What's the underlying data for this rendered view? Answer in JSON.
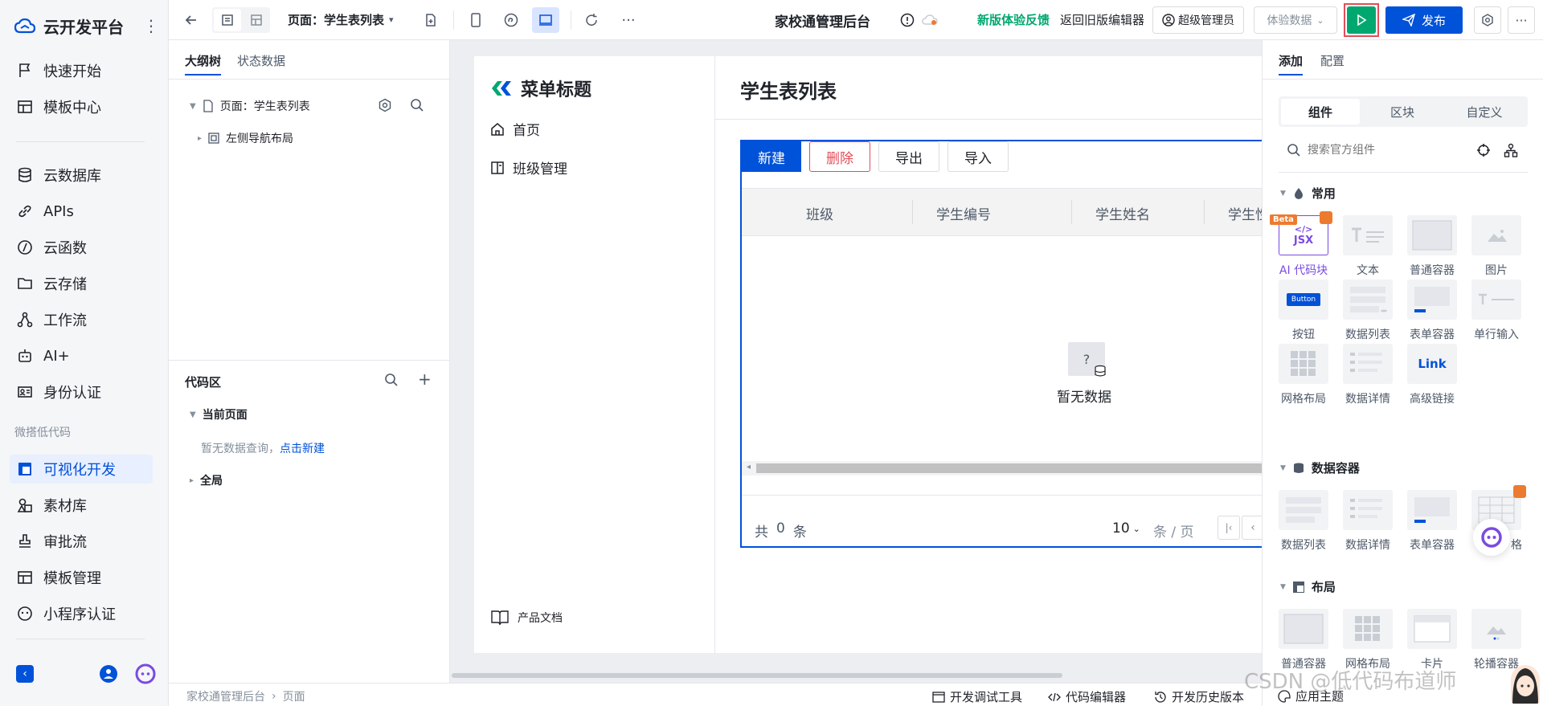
{
  "brand": {
    "name": "云开发平台"
  },
  "sidebar": {
    "items": [
      {
        "label": "快速开始"
      },
      {
        "label": "模板中心"
      },
      {
        "label": "云数据库"
      },
      {
        "label": "APIs"
      },
      {
        "label": "云函数"
      },
      {
        "label": "云存储"
      },
      {
        "label": "工作流"
      },
      {
        "label": "AI+"
      },
      {
        "label": "身份认证"
      },
      {
        "label": "可视化开发"
      },
      {
        "label": "素材库"
      },
      {
        "label": "审批流"
      },
      {
        "label": "模板管理"
      },
      {
        "label": "小程序认证"
      }
    ],
    "group_label": "微搭低代码"
  },
  "toolbar": {
    "page_selector": "页面：学生表列表",
    "app_title": "家校通管理后台",
    "feedback_link": "新版体验反馈",
    "old_editor_link": "返回旧版编辑器",
    "user_label": "超级管理员",
    "data_mode": "体验数据",
    "publish_label": "发布"
  },
  "outline": {
    "tabs": [
      "大纲树",
      "状态数据"
    ],
    "tree": {
      "page": "页面：学生表列表",
      "child": "左侧导航布局"
    },
    "code_area": {
      "title": "代码区",
      "current_page": "当前页面",
      "empty_text": "暂无数据查询，",
      "create_link": "点击新建",
      "global": "全局"
    }
  },
  "preview": {
    "menu_title": "菜单标题",
    "menu_items": [
      "首页",
      "班级管理"
    ],
    "footer_link": "产品文档",
    "page_title": "学生表列表",
    "buttons": {
      "new": "新建",
      "delete": "删除",
      "export": "导出",
      "import": "导入"
    },
    "columns": [
      "班级",
      "学生编号",
      "学生姓名",
      "学生性"
    ],
    "empty": "暂无数据",
    "total_prefix": "共",
    "total_count": "0",
    "total_suffix": "条",
    "page_size": "10",
    "page_unit": "条 / 页"
  },
  "rightpanel": {
    "tabs": [
      "添加",
      "配置"
    ],
    "segments": [
      "组件",
      "区块",
      "自定义"
    ],
    "search_placeholder": "搜索官方组件",
    "sections": {
      "common": {
        "title": "常用",
        "items": [
          "AI 代码块",
          "文本",
          "普通容器",
          "图片",
          "按钮",
          "数据列表",
          "表单容器",
          "单行输入",
          "网格布局",
          "数据详情",
          "高级链接"
        ]
      },
      "data": {
        "title": "数据容器",
        "items": [
          "数据列表",
          "数据详情",
          "表单容器",
          "格"
        ]
      },
      "layout": {
        "title": "布局",
        "items": [
          "普通容器",
          "网格布局",
          "卡片",
          "轮播容器"
        ]
      }
    },
    "ai_badge": "Beta",
    "ai_thumb": "JSX",
    "button_thumb": "Button",
    "link_thumb": "Link",
    "empty_thumb": "?"
  },
  "bottombar": {
    "breadcrumb": [
      "家校通管理后台",
      "页面"
    ],
    "tools": [
      "开发调试工具",
      "代码编辑器",
      "开发历史版本",
      "应用主题"
    ]
  },
  "watermark": "CSDN @低代码布道师",
  "colors": {
    "primary": "#0052d9",
    "success": "#00a870",
    "danger": "#e34d59",
    "accent": "#ed7b2f"
  }
}
